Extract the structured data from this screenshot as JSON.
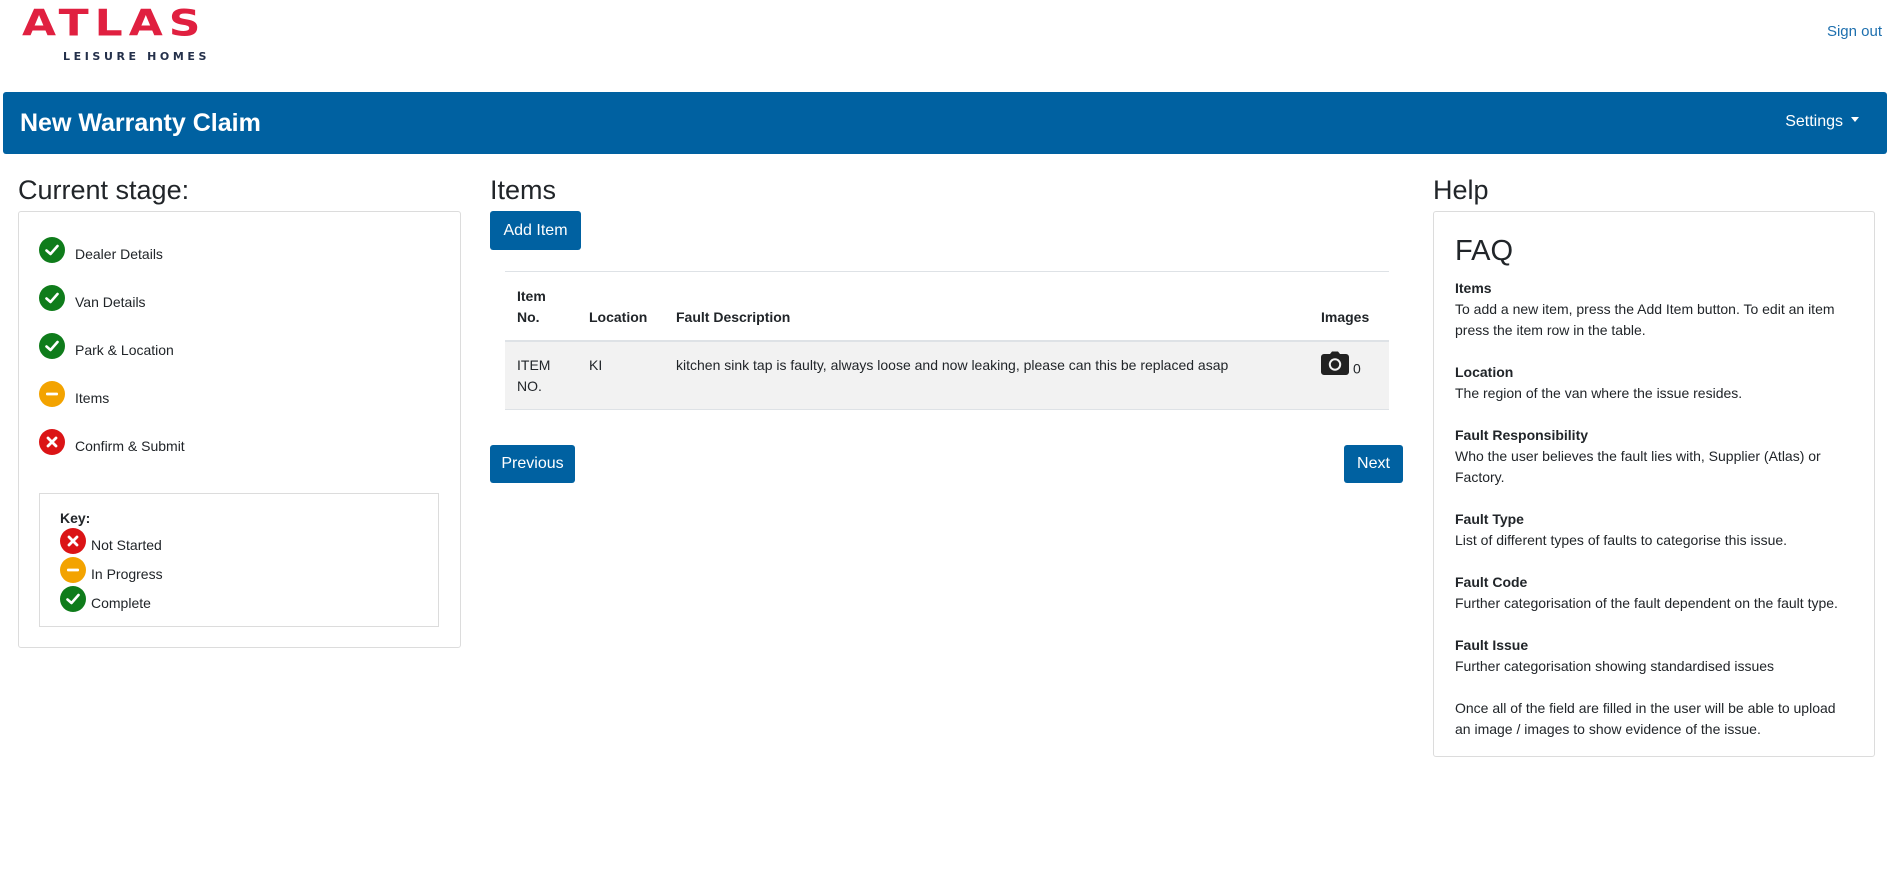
{
  "header": {
    "logo_text": "ATLAS",
    "logo_subtext": "LEISURE HOMES",
    "sign_out": "Sign out"
  },
  "titlebar": {
    "title": "New Warranty Claim",
    "settings": "Settings"
  },
  "stage": {
    "heading": "Current stage:",
    "items": [
      {
        "label": "Dealer Details",
        "status": "complete"
      },
      {
        "label": "Van Details",
        "status": "complete"
      },
      {
        "label": "Park & Location",
        "status": "complete"
      },
      {
        "label": "Items",
        "status": "in-progress"
      },
      {
        "label": "Confirm & Submit",
        "status": "not-started"
      }
    ],
    "key": {
      "title": "Key:",
      "not_started": "Not Started",
      "in_progress": "In Progress",
      "complete": "Complete"
    }
  },
  "items": {
    "heading": "Items",
    "add_button": "Add Item",
    "columns": {
      "item_no": "Item No.",
      "location": "Location",
      "fault": "Fault Description",
      "images": "Images"
    },
    "rows": [
      {
        "item_no": "ITEM NO.",
        "location": "KI",
        "fault": "kitchen sink tap is faulty, always loose and now leaking, please can this be replaced asap",
        "images": "0"
      }
    ],
    "previous": "Previous",
    "next": "Next"
  },
  "help": {
    "heading": "Help",
    "faq_title": "FAQ",
    "entries": [
      {
        "q": "Items",
        "a": "To add a new item, press the Add Item button. To edit an item press the item row in the table."
      },
      {
        "q": "Location",
        "a": "The region of the van where the issue resides."
      },
      {
        "q": "Fault Responsibility",
        "a": "Who the user believes the fault lies with, Supplier (Atlas) or Factory."
      },
      {
        "q": "Fault Type",
        "a": "List of different types of faults to categorise this issue."
      },
      {
        "q": "Fault Code",
        "a": "Further categorisation of the fault dependent on the fault type."
      },
      {
        "q": "Fault Issue",
        "a": "Further categorisation showing standardised issues"
      }
    ],
    "footer": "Once all of the field are filled in the user will be able to upload an image / images to show evidence of the issue."
  },
  "colors": {
    "brand": "#0061a1",
    "logo": "#e02040",
    "complete": "#0f7c1b",
    "in_progress": "#f3a300",
    "not_started": "#db1416"
  },
  "icons": {
    "complete": "check-icon",
    "in_progress": "minus-icon",
    "not_started": "cross-icon",
    "images": "camera-icon",
    "settings": "caret-down-icon"
  }
}
